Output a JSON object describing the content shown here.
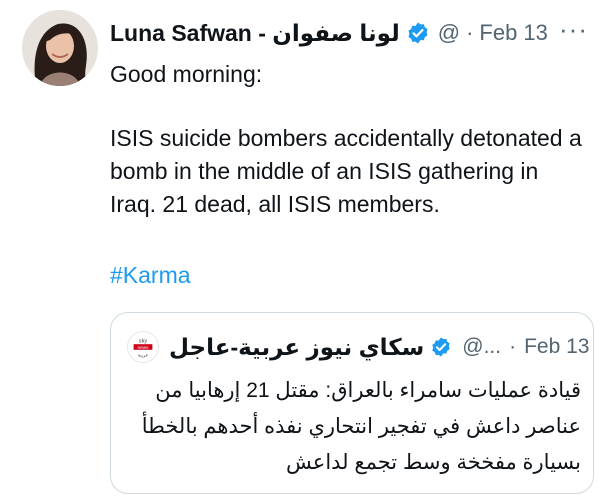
{
  "tweet": {
    "author_name": "Luna Safwan - لونا صفوان",
    "handle": "@",
    "separator": "·",
    "date": "Feb 13",
    "more": "···",
    "greeting": "Good morning:",
    "body": "ISIS suicide bombers accidentally detonated a bomb in the middle of an ISIS gathering in Iraq. 21 dead, all ISIS members.",
    "hashtag": "#Karma",
    "verified_icon": "verified-badge-icon",
    "colors": {
      "verified": "#1d9bf0",
      "hashtag": "#1d9bf0",
      "muted": "#536471",
      "border": "#cfd9de"
    }
  },
  "quoted": {
    "author_name": "سكاي نيوز عربية-عاجل",
    "handle": "@...",
    "separator": "·",
    "date": "Feb 13",
    "lines": [
      "قيادة عمليات سامراء بالعراق: مقتل 21 إرهابيا من",
      "عناصر داعش في تفجير انتحاري نفذه أحدهم بالخطأ",
      "بسيارة مفخخة وسط تجمع لداعش"
    ],
    "logo_text": "sky news عربية"
  }
}
